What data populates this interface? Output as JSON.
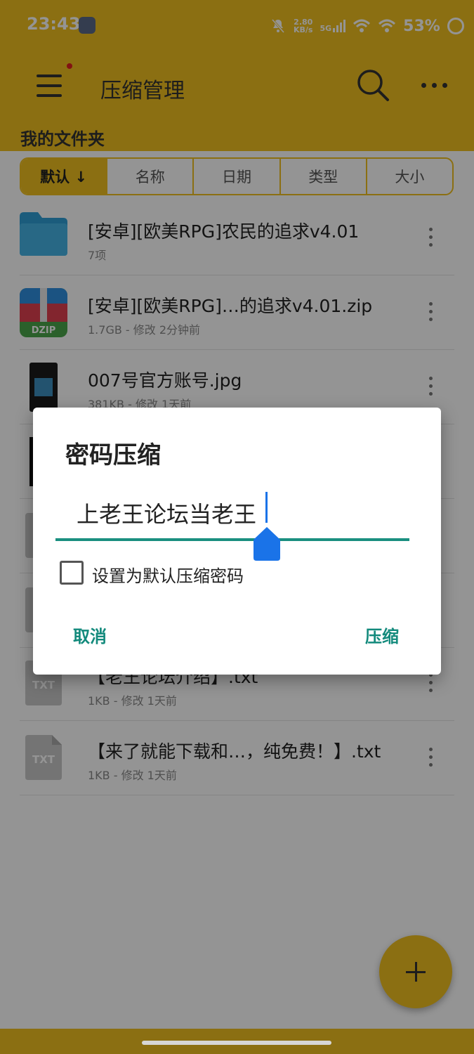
{
  "status_bar": {
    "time": "23:43",
    "speed_value": "2.80",
    "speed_unit": "KB/s",
    "network": "5G",
    "battery": "53%"
  },
  "app_bar": {
    "title": "压缩管理",
    "folder": "我的文件夹",
    "icons": [
      "menu-icon",
      "search-icon",
      "more-icon"
    ]
  },
  "sort_tabs": [
    "默认 ↓",
    "名称",
    "日期",
    "类型",
    "大小"
  ],
  "files": [
    {
      "name": "[安卓][欧美RPG]农民的追求v4.01",
      "meta": "7项",
      "icon": "folder"
    },
    {
      "name": "[安卓][欧美RPG]…的追求v4.01.zip",
      "meta": "1.7GB - 修改 2分钟前",
      "icon": "dzip",
      "icon_label": "DZIP"
    },
    {
      "name": "007号官方账号.jpg",
      "meta": "381KB - 修改 1天前",
      "icon": "image"
    },
    {
      "name": "",
      "meta": "",
      "icon": "image-dark"
    },
    {
      "name": "",
      "meta": "",
      "icon": "txt"
    },
    {
      "name": "",
      "meta": "",
      "icon": "txt"
    },
    {
      "name": "【老王论坛介绍】.txt",
      "meta": "1KB - 修改 1天前",
      "icon": "txt",
      "icon_label": "TXT"
    },
    {
      "name": "【来了就能下载和…，纯免费！】.txt",
      "meta": "1KB - 修改 1天前",
      "icon": "txt",
      "icon_label": "TXT"
    }
  ],
  "dialog": {
    "title": "密码压缩",
    "password": "上老王论坛当老王",
    "checkbox_label": "设置为默认压缩密码",
    "checkbox_checked": false,
    "cancel": "取消",
    "confirm": "压缩"
  },
  "colors": {
    "accent": "#F0C020",
    "dialog_button": "#138a7c",
    "input_underline": "#1a8f80",
    "caret": "#1a73e8"
  }
}
